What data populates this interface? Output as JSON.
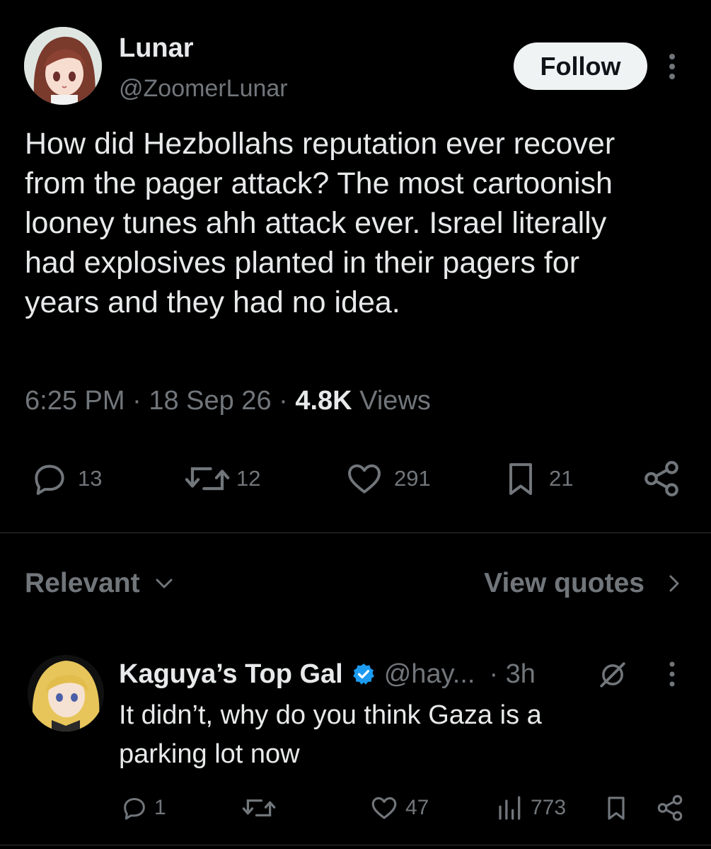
{
  "tweet": {
    "author_name": "Lunar",
    "author_handle": "@ZoomerLunar",
    "follow_label": "Follow",
    "text": "How did Hezbollahs reputation ever recover from the pager attack? The most cartoonish looney tunes ahh attack ever. Israel literally had explosives planted in their pagers for years and they had no idea.",
    "time": "6:25 PM",
    "date": "18 Sep 26",
    "views_count": "4.8K",
    "views_label": "Views",
    "replies": "13",
    "reposts": "12",
    "likes": "291",
    "bookmarks": "21"
  },
  "sort": {
    "label": "Relevant",
    "view_quotes_label": "View quotes"
  },
  "reply": {
    "author_name": "Kaguya’s Top Gal",
    "author_handle": "@hay...",
    "time": "· 3h",
    "text": "It didn’t, why do you think Gaza is a parking lot now",
    "replies": "1",
    "likes": "47",
    "views": "773"
  },
  "colors": {
    "background": "#000000",
    "text": "#e7e9ea",
    "muted": "#71767b",
    "verified": "#1d9bf0",
    "divider": "#2f3336"
  }
}
